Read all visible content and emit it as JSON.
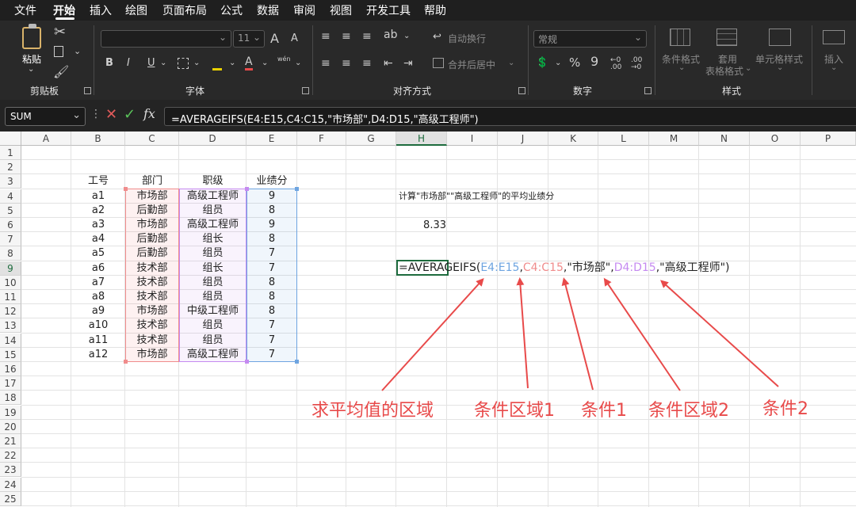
{
  "menu": {
    "items": [
      "文件",
      "开始",
      "插入",
      "绘图",
      "页面布局",
      "公式",
      "数据",
      "审阅",
      "视图",
      "开发工具",
      "帮助"
    ],
    "active": "开始"
  },
  "ribbon": {
    "clipboard": {
      "paste_label": "粘贴",
      "group_label": "剪贴板"
    },
    "font": {
      "size_value": "11",
      "group_label": "字体",
      "grow_label": "A",
      "shrink_label": "A",
      "bold": "B",
      "italic": "I",
      "underline": "U",
      "font_color": "A",
      "phonetic": "wén"
    },
    "alignment": {
      "wrap_text": "自动换行",
      "merge_center": "合并后居中",
      "group_label": "对齐方式"
    },
    "number": {
      "format_value": "常规",
      "percent": "%",
      "comma": "9",
      "group_label": "数字"
    },
    "styles": {
      "conditional_format": "条件格式",
      "format_table_1": "套用",
      "format_table_2": "表格格式",
      "cell_styles": "单元格样式",
      "group_label": "样式"
    },
    "cells": {
      "insert": "插入"
    }
  },
  "formula_bar": {
    "name_box": "SUM",
    "fx": "fx",
    "formula": "=AVERAGEIFS(E4:E15,C4:C15,\"市场部\",D4:D15,\"高级工程师\")"
  },
  "columns": [
    "A",
    "B",
    "C",
    "D",
    "E",
    "F",
    "G",
    "H",
    "I",
    "J",
    "K",
    "L",
    "M",
    "N",
    "O",
    "P"
  ],
  "rows": [
    "1",
    "2",
    "3",
    "4",
    "5",
    "6",
    "7",
    "8",
    "9",
    "10",
    "11",
    "12",
    "13",
    "14",
    "15",
    "16",
    "17",
    "18",
    "19",
    "20",
    "21",
    "22",
    "23",
    "24",
    "25"
  ],
  "table": {
    "headers": [
      "工号",
      "部门",
      "职级",
      "业绩分"
    ],
    "rows": [
      [
        "a1",
        "市场部",
        "高级工程师",
        "9"
      ],
      [
        "a2",
        "后勤部",
        "组员",
        "8"
      ],
      [
        "a3",
        "市场部",
        "高级工程师",
        "9"
      ],
      [
        "a4",
        "后勤部",
        "组长",
        "8"
      ],
      [
        "a5",
        "后勤部",
        "组员",
        "7"
      ],
      [
        "a6",
        "技术部",
        "组长",
        "7"
      ],
      [
        "a7",
        "技术部",
        "组员",
        "8"
      ],
      [
        "a8",
        "技术部",
        "组员",
        "8"
      ],
      [
        "a9",
        "市场部",
        "中级工程师",
        "8"
      ],
      [
        "a10",
        "技术部",
        "组员",
        "7"
      ],
      [
        "a11",
        "技术部",
        "组员",
        "7"
      ],
      [
        "a12",
        "市场部",
        "高级工程师",
        "7"
      ]
    ]
  },
  "sheet_cells": {
    "h4_caption": "计算\"市场部\"\"高级工程师\"的平均业绩分",
    "h6_result": "8.33"
  },
  "edit_formula": {
    "p1": "=AVERAGEIFS(",
    "r1": "E4:E15",
    "c1": ",",
    "r2": "C4:C15",
    "s1": ",\"市场部\",",
    "r3": "D4:D15",
    "s2": ",\"高级工程师\")"
  },
  "annotations": [
    "求平均值的区域",
    "条件区域1",
    "条件1",
    "条件区域2",
    "条件2"
  ],
  "colors": {
    "range_e": "#6ea4e0",
    "range_c": "#f08c8c",
    "range_d": "#c58af0",
    "annotation": "#e84a4a",
    "active_cell": "#1d6b3d"
  }
}
